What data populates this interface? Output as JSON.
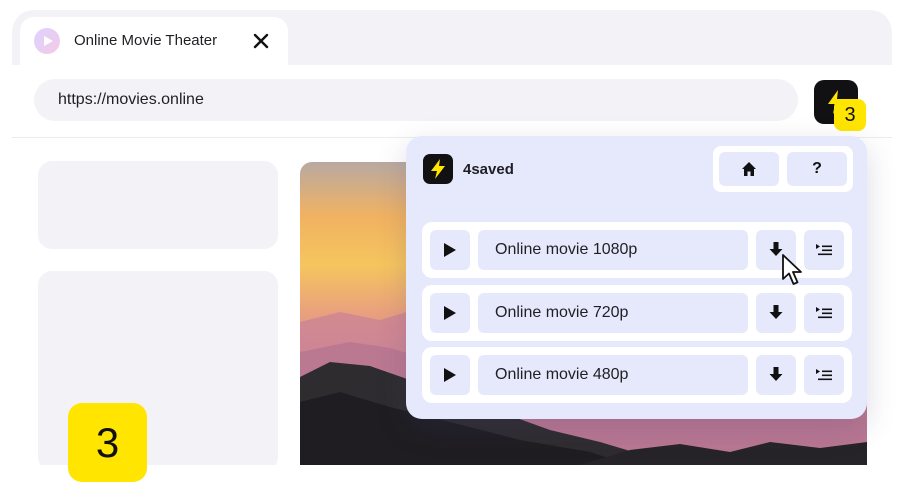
{
  "browser": {
    "tab": {
      "title": "Online Movie Theater",
      "favicon_icon": "play-icon",
      "close_icon": "close-icon"
    },
    "address_bar": {
      "url": "https://movies.online"
    },
    "extension": {
      "icon": "lightning-icon",
      "badge_count": "3"
    }
  },
  "popup": {
    "brand": "4saved",
    "logo_icon": "lightning-icon",
    "nav": [
      {
        "icon": "home-icon",
        "label": ""
      },
      {
        "icon": "help-icon",
        "label": "?"
      }
    ],
    "downloads": [
      {
        "label": "Online movie 1080p"
      },
      {
        "label": "Online movie 720p"
      },
      {
        "label": "Online movie 480p"
      }
    ]
  },
  "step_badge": "3",
  "colors": {
    "accent_yellow": "#ffe500",
    "popup_bg": "#e6e9fb",
    "dark": "#111114",
    "placeholder": "#f2f2f7"
  }
}
